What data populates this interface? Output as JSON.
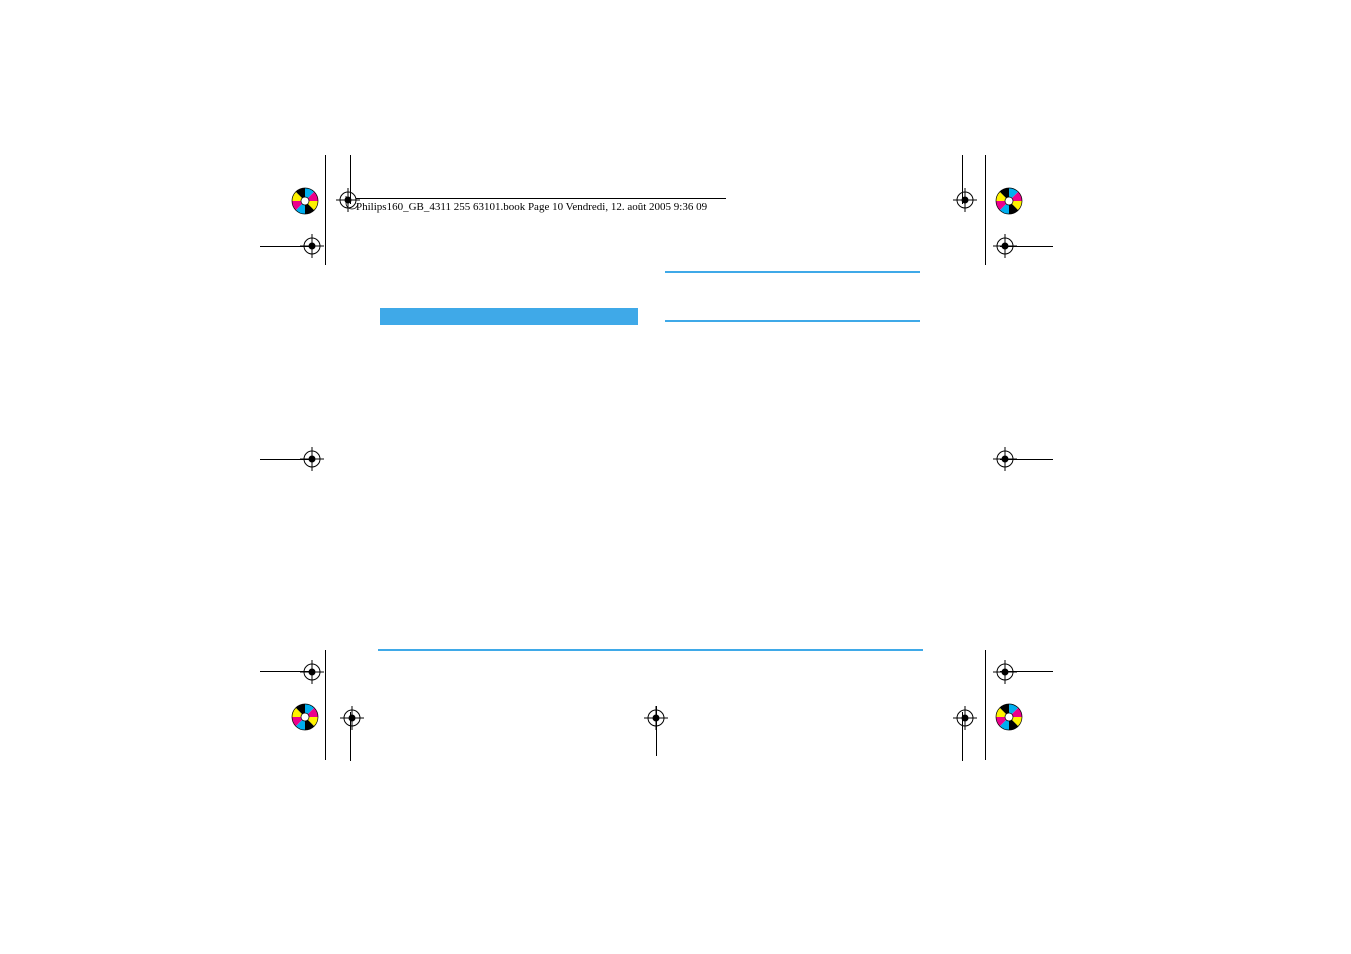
{
  "header": {
    "text": "Philips160_GB_4311 255 63101.book  Page 10  Vendredi, 12. août 2005  9:36 09"
  },
  "marks": {
    "registration": "registration-mark",
    "rosette": "rosette-mark"
  }
}
